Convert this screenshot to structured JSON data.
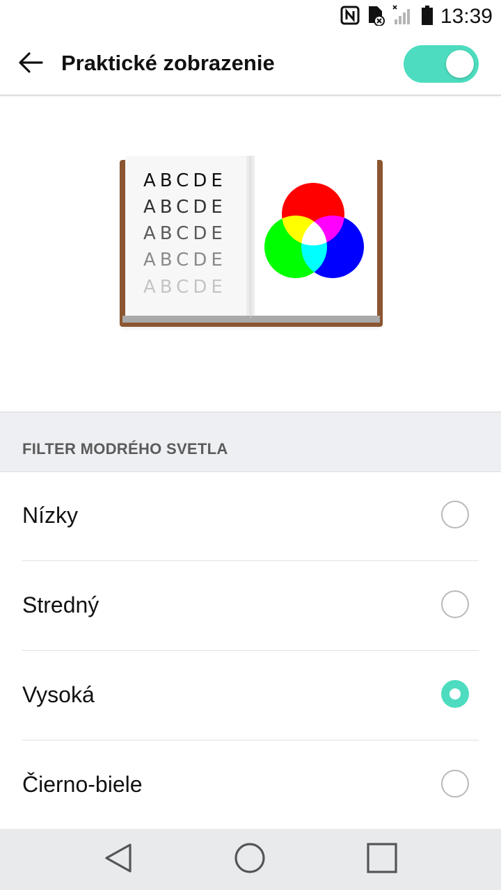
{
  "status_bar": {
    "time": "13:39",
    "icons": [
      "nfc-icon",
      "sim-error-icon",
      "signal-icon",
      "battery-icon"
    ]
  },
  "app_bar": {
    "title": "Praktické zobrazenie",
    "back_icon": "arrow-left-icon",
    "toggle_on": true,
    "accent_color": "#4ddcbf"
  },
  "illustration": {
    "letter_rows": [
      "ABCDE",
      "ABCDE",
      "ABCDE",
      "ABCDE",
      "ABCDE"
    ],
    "row_colors": [
      "#111111",
      "#333333",
      "#5a5a5a",
      "#8a8a8a",
      "#c4c4c4"
    ],
    "circle_colors": [
      "#ff0000",
      "#00ff00",
      "#0000ff"
    ]
  },
  "section": {
    "header": "FILTER MODRÉHO SVETLA"
  },
  "options": [
    {
      "label": "Nízky",
      "selected": false
    },
    {
      "label": "Stredný",
      "selected": false
    },
    {
      "label": "Vysoká",
      "selected": true
    },
    {
      "label": "Čierno-biele",
      "selected": false
    }
  ],
  "nav_bar": {
    "buttons": [
      "back-nav-icon",
      "home-nav-icon",
      "recents-nav-icon"
    ]
  }
}
